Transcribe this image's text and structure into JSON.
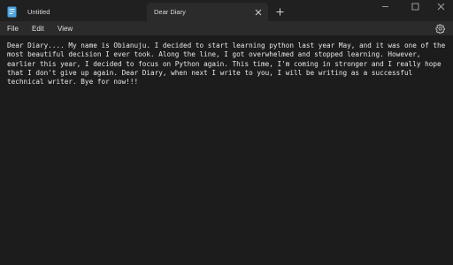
{
  "tabs": [
    {
      "label": "Untitled",
      "icon": "notepad-icon",
      "active": false
    },
    {
      "label": "Dear Diary",
      "active": true
    }
  ],
  "menu": {
    "file": "File",
    "edit": "Edit",
    "view": "View"
  },
  "document": {
    "text": "Dear Diary.... My name is Obianuju. I decided to start learning python last year May, and it was one of the most beautiful decision I ever took. Along the line, I got overwhelmed and stopped learning. However, earlier this year, I decided to focus on Python again. This time, I'm coming in stronger and I really hope that I don't give up again. Dear Diary, when next I write to you, I will be writing as a successful technical writer. Bye for now!!!"
  },
  "colors": {
    "titlebar": "#202020",
    "menubar": "#2b2b2b",
    "editor": "#1c1c1c",
    "accent": "#4aa3df"
  }
}
